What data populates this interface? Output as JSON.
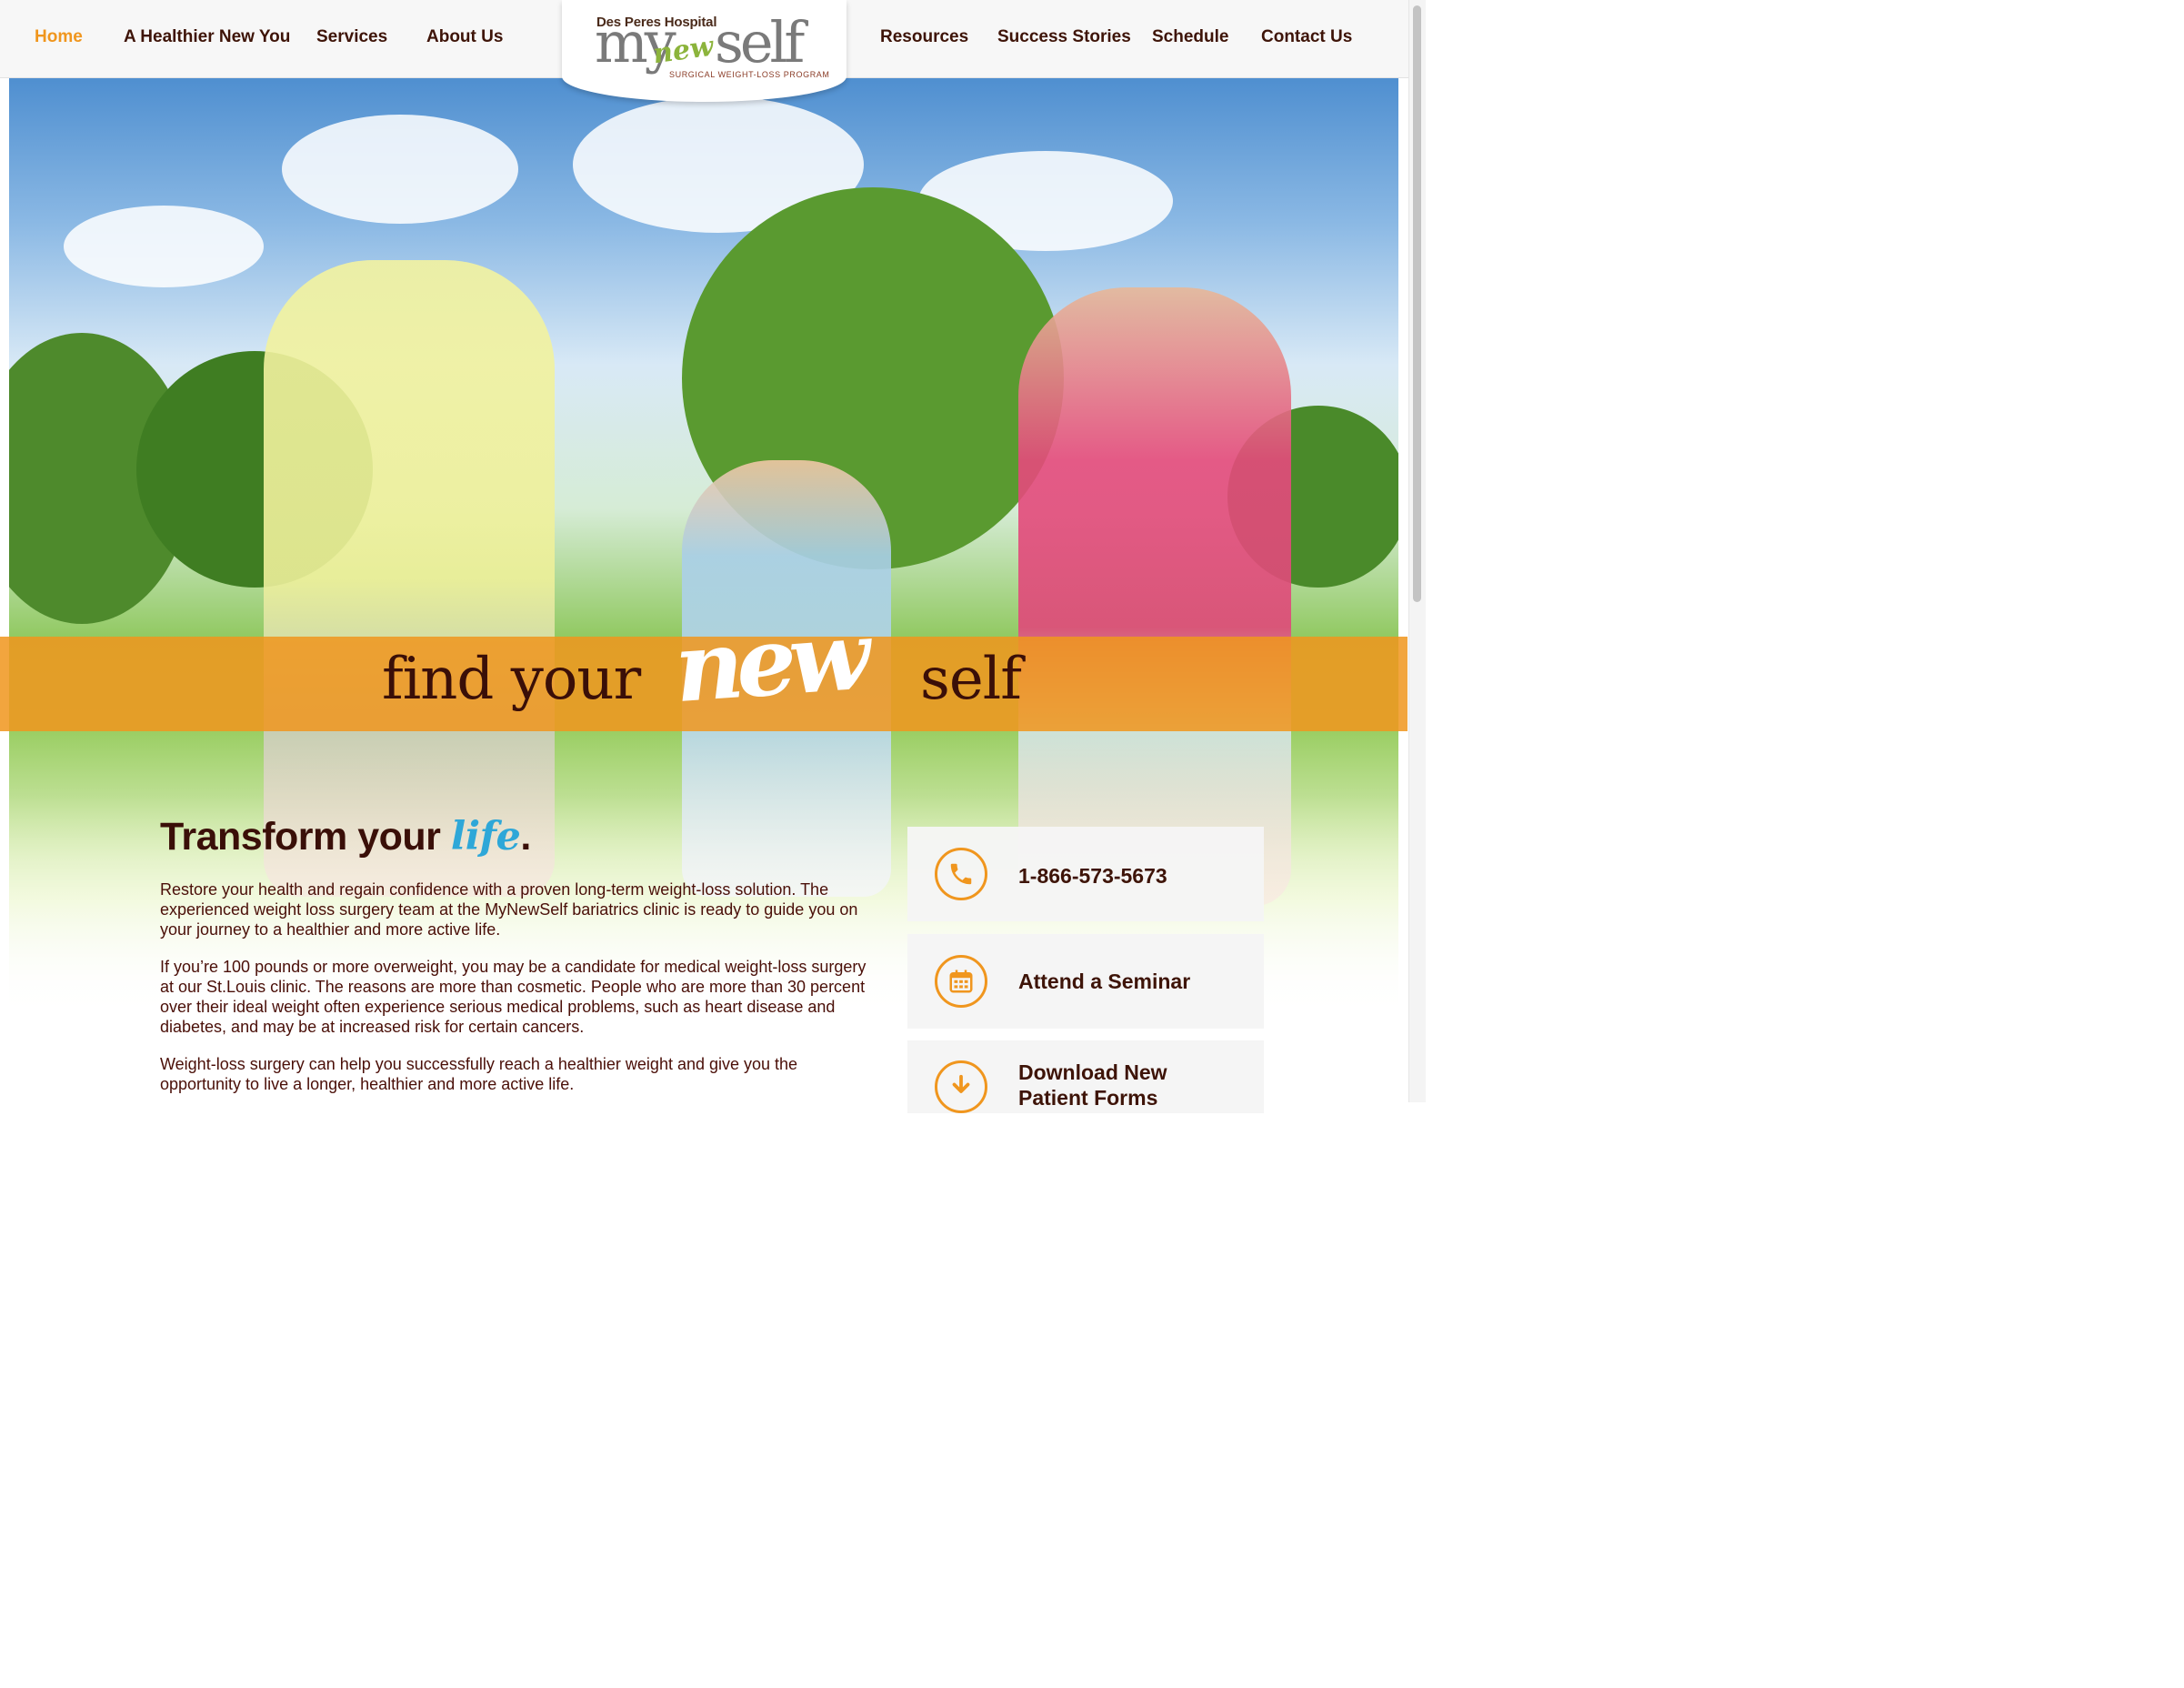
{
  "nav": {
    "left": [
      "Home",
      "A Healthier New You",
      "Services",
      "About Us"
    ],
    "right": [
      "Resources",
      "Success Stories",
      "Schedule",
      "Contact Us"
    ],
    "active": "Home"
  },
  "logo": {
    "hospital": "Des Peres Hospital",
    "my": "my",
    "new": "new",
    "self": "self",
    "tagline": "SURGICAL WEIGHT-LOSS PROGRAM"
  },
  "banner": {
    "pre": "find your",
    "highlight": "new",
    "post": "self"
  },
  "content": {
    "headline_main": "Transform your",
    "headline_accent": "life",
    "headline_end": ".",
    "paragraphs": [
      "Restore your health and regain confidence with a proven long-term weight-loss solution. The experienced weight loss surgery team at the MyNewSelf bariatrics clinic is ready to guide you on your journey to a healthier and more active life.",
      "If you’re 100 pounds or more overweight, you may be a candidate for medical weight-loss surgery at our St.Louis clinic. The reasons are more than cosmetic. People who are more than 30 percent over their ideal weight often experience serious medical problems, such as heart disease and diabetes, and may be at increased risk for certain cancers.",
      "Weight-loss surgery can help you successfully reach a healthier weight and give you the opportunity to live a longer, healthier and more active life."
    ]
  },
  "cta": {
    "phone": {
      "label": "1-866-573-5673",
      "icon": "phone-icon"
    },
    "seminar": {
      "label": "Attend a Seminar",
      "icon": "calendar-icon"
    },
    "forms": {
      "label": "Download New Patient Forms",
      "icon": "download-icon"
    }
  },
  "colors": {
    "accent": "#f0961e",
    "text": "#3e1408",
    "life": "#2ea7d8"
  }
}
